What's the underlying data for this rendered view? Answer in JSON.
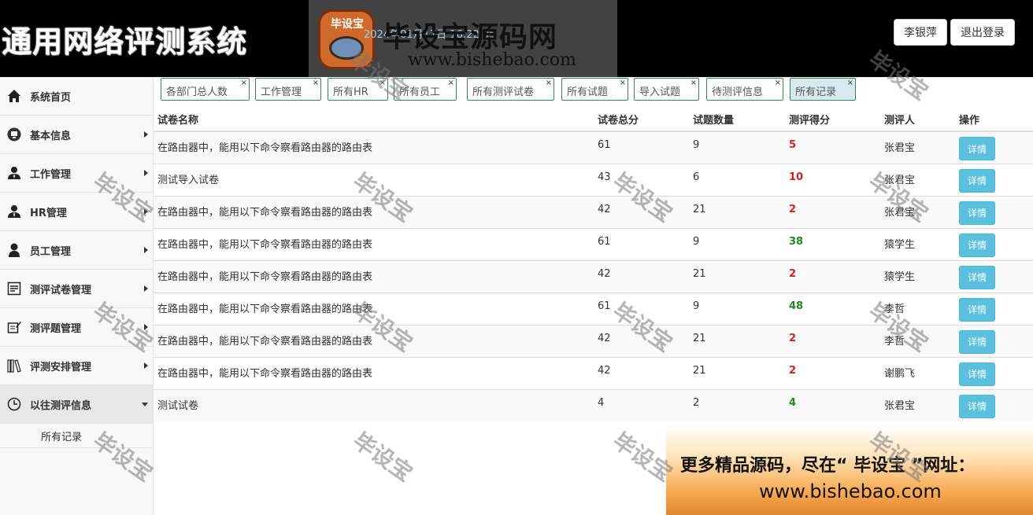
{
  "header": {
    "app_title": "通用网络评测系统",
    "datetime": "2024年01月17日 16:22:05",
    "user_name": "李银萍",
    "logout_label": "退出登录"
  },
  "watermark": {
    "logo_badge": "毕设宝",
    "logo_text": "毕设宝源码网",
    "logo_url": "www.bishebao.com",
    "diagonal_text": "毕设宝",
    "banner_line1": "更多精品源码，尽在“ 毕设宝 ”网址：",
    "banner_line2": "www.bishebao.com"
  },
  "sidebar": {
    "items": [
      {
        "label": "系统首页",
        "icon": "home-icon"
      },
      {
        "label": "基本信息",
        "icon": "monitor-icon"
      },
      {
        "label": "工作管理",
        "icon": "user-tie-icon"
      },
      {
        "label": "HR管理",
        "icon": "user-tie-icon"
      },
      {
        "label": "员工管理",
        "icon": "user-icon"
      },
      {
        "label": "测评试卷管理",
        "icon": "document-icon"
      },
      {
        "label": "测评题管理",
        "icon": "edit-icon"
      },
      {
        "label": "评测安排管理",
        "icon": "books-icon"
      },
      {
        "label": "以往测评信息",
        "icon": "clock-icon"
      }
    ],
    "subitems": [
      "所有记录"
    ]
  },
  "tabs": [
    {
      "label": "各部门总人数"
    },
    {
      "label": "工作管理"
    },
    {
      "label": "所有HR"
    },
    {
      "label": "所有员工"
    },
    {
      "label": "所有测评试卷"
    },
    {
      "label": "所有试题"
    },
    {
      "label": "导入试题"
    },
    {
      "label": "待测评信息"
    },
    {
      "label": "所有记录"
    }
  ],
  "table": {
    "columns": [
      "试卷名称",
      "试卷总分",
      "试题数量",
      "测评得分",
      "测评人",
      "操作"
    ],
    "detail_label": "详情",
    "rows": [
      {
        "name": "在路由器中，能用以下命令察看路由器的路由表",
        "total": "61",
        "count": "9",
        "score": "5",
        "score_color": "#d9211c",
        "person": "张君宝"
      },
      {
        "name": "测试导入试卷",
        "total": "43",
        "count": "6",
        "score": "10",
        "score_color": "#d9211c",
        "person": "张君宝"
      },
      {
        "name": "在路由器中，能用以下命令察看路由器的路由表",
        "total": "42",
        "count": "21",
        "score": "2",
        "score_color": "#d9211c",
        "person": "张君宝"
      },
      {
        "name": "在路由器中，能用以下命令察看路由器的路由表",
        "total": "61",
        "count": "9",
        "score": "38",
        "score_color": "#1e8a1e",
        "person": "猿学生"
      },
      {
        "name": "在路由器中，能用以下命令察看路由器的路由表",
        "total": "42",
        "count": "21",
        "score": "2",
        "score_color": "#d9211c",
        "person": "猿学生"
      },
      {
        "name": "在路由器中，能用以下命令察看路由器的路由表",
        "total": "61",
        "count": "9",
        "score": "48",
        "score_color": "#1e8a1e",
        "person": "李哲"
      },
      {
        "name": "在路由器中，能用以下命令察看路由器的路由表",
        "total": "42",
        "count": "21",
        "score": "2",
        "score_color": "#d9211c",
        "person": "李哲"
      },
      {
        "name": "在路由器中，能用以下命令察看路由器的路由表",
        "total": "42",
        "count": "21",
        "score": "2",
        "score_color": "#d9211c",
        "person": "谢鹏飞"
      },
      {
        "name": "测试试卷",
        "total": "4",
        "count": "2",
        "score": "4",
        "score_color": "#1e8a1e",
        "person": "张君宝"
      }
    ]
  }
}
